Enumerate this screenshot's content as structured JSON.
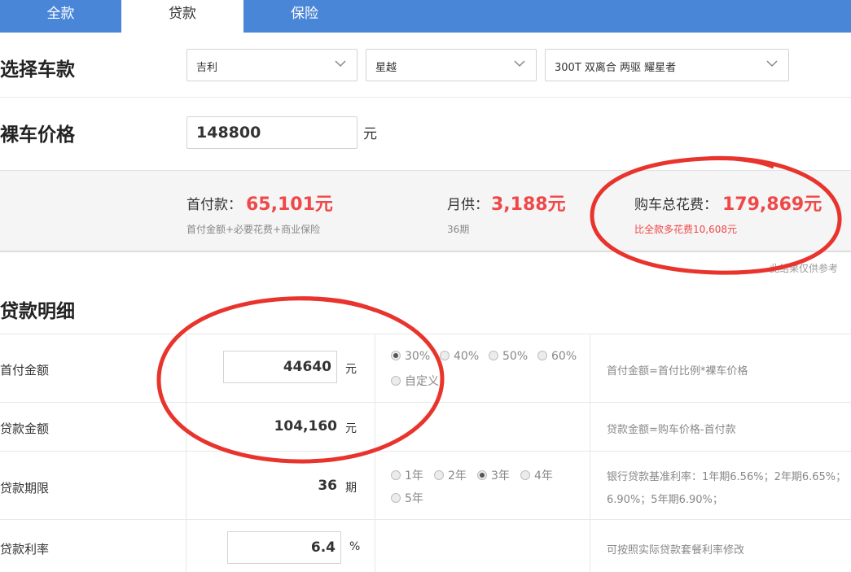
{
  "tabs": [
    {
      "label": "全款"
    },
    {
      "label": "贷款"
    },
    {
      "label": "保险"
    }
  ],
  "active_tab": "贷款",
  "car_select": {
    "heading": "选择车款",
    "brand": "吉利",
    "series": "星越",
    "model": "300T 双离合 两驱 耀星者"
  },
  "price": {
    "heading": "裸车价格",
    "value": "148800",
    "unit": "元"
  },
  "summary": {
    "down_payment_label": "首付款：",
    "down_payment_value": "65,101元",
    "down_payment_sub": "首付金额+必要花费+商业保险",
    "monthly_label": "月供：",
    "monthly_value": "3,188元",
    "monthly_sub": "36期",
    "total_label": "购车总花费：",
    "total_value": "179,869元",
    "total_sub": "比全款多花费10,608元",
    "note": "此结果仅供参考"
  },
  "loan": {
    "heading": "贷款明细",
    "down_amount": {
      "label": "首付金额",
      "value": "44640",
      "unit": "元",
      "options": [
        "30%",
        "40%",
        "50%",
        "60%",
        "自定义"
      ],
      "selected": "30%",
      "hint": "首付金额=首付比例*裸车价格"
    },
    "loan_amount": {
      "label": "贷款金额",
      "value": "104,160",
      "unit": "元",
      "hint": "贷款金额=购车价格-首付款"
    },
    "term": {
      "label": "贷款期限",
      "value": "36",
      "unit": "期",
      "options": [
        "1年",
        "2年",
        "3年",
        "4年",
        "5年"
      ],
      "selected": "3年",
      "hint_line1": "银行贷款基准利率：1年期6.56%；2年期6.65%；",
      "hint_line2": "6.90%；5年期6.90%；"
    },
    "rate": {
      "label": "贷款利率",
      "value": "6.4",
      "unit": "%",
      "hint": "可按照实际贷款套餐利率修改"
    }
  },
  "colors": {
    "tab_bar": "#4a86d8",
    "accent_red": "#f04848",
    "annotation_ring": "#e8342d"
  },
  "icons": [
    "chevron-down-icon",
    "radio-icon"
  ]
}
